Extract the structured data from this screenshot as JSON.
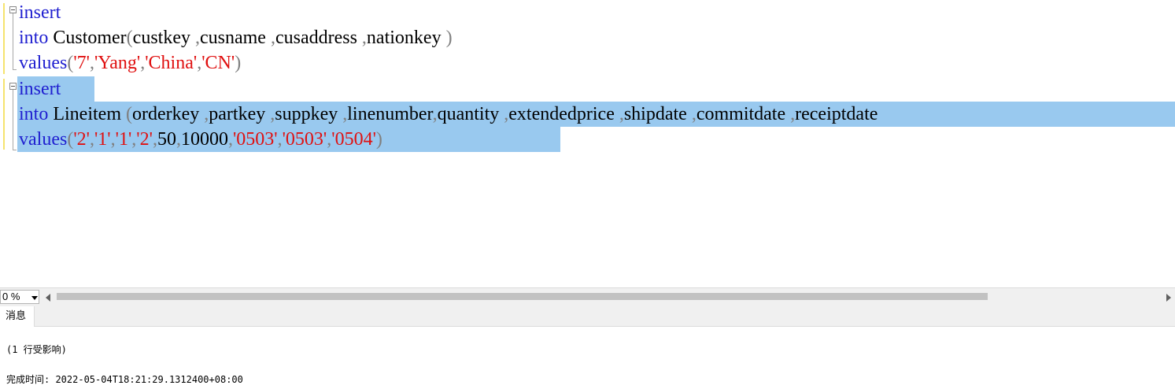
{
  "editor": {
    "lines": [
      [
        {
          "t": "insert",
          "c": "kw"
        }
      ],
      [
        {
          "t": "into",
          "c": "kw"
        },
        {
          "t": " Customer",
          "c": "txt"
        },
        {
          "t": "(",
          "c": "gray"
        },
        {
          "t": "custkey ",
          "c": "txt"
        },
        {
          "t": ",",
          "c": "gray"
        },
        {
          "t": "cusname ",
          "c": "txt"
        },
        {
          "t": ",",
          "c": "gray"
        },
        {
          "t": "cusaddress ",
          "c": "txt"
        },
        {
          "t": ",",
          "c": "gray"
        },
        {
          "t": "nationkey ",
          "c": "txt"
        },
        {
          "t": ")",
          "c": "gray"
        }
      ],
      [
        {
          "t": "values",
          "c": "kw"
        },
        {
          "t": "(",
          "c": "gray"
        },
        {
          "t": "'7'",
          "c": "str"
        },
        {
          "t": ",",
          "c": "gray"
        },
        {
          "t": "'Yang'",
          "c": "str"
        },
        {
          "t": ",",
          "c": "gray"
        },
        {
          "t": "'China'",
          "c": "str"
        },
        {
          "t": ",",
          "c": "gray"
        },
        {
          "t": "'CN'",
          "c": "str"
        },
        {
          "t": ")",
          "c": "gray"
        }
      ],
      [
        {
          "t": "insert",
          "c": "kw"
        }
      ],
      [
        {
          "t": "into",
          "c": "kw"
        },
        {
          "t": " Lineitem ",
          "c": "txt"
        },
        {
          "t": "(",
          "c": "gray"
        },
        {
          "t": "orderkey ",
          "c": "txt"
        },
        {
          "t": ",",
          "c": "gray"
        },
        {
          "t": "partkey ",
          "c": "txt"
        },
        {
          "t": ",",
          "c": "gray"
        },
        {
          "t": "suppkey ",
          "c": "txt"
        },
        {
          "t": ",",
          "c": "gray"
        },
        {
          "t": "linenumber",
          "c": "txt"
        },
        {
          "t": ",",
          "c": "gray"
        },
        {
          "t": "quantity ",
          "c": "txt"
        },
        {
          "t": ",",
          "c": "gray"
        },
        {
          "t": "extendedprice ",
          "c": "txt"
        },
        {
          "t": ",",
          "c": "gray"
        },
        {
          "t": "shipdate ",
          "c": "txt"
        },
        {
          "t": ",",
          "c": "gray"
        },
        {
          "t": "commitdate ",
          "c": "txt"
        },
        {
          "t": ",",
          "c": "gray"
        },
        {
          "t": "receiptdate",
          "c": "txt"
        }
      ],
      [
        {
          "t": "values",
          "c": "kw"
        },
        {
          "t": "(",
          "c": "gray"
        },
        {
          "t": "'2'",
          "c": "str"
        },
        {
          "t": ",",
          "c": "gray"
        },
        {
          "t": "'1'",
          "c": "str"
        },
        {
          "t": ",",
          "c": "gray"
        },
        {
          "t": "'1'",
          "c": "str"
        },
        {
          "t": ",",
          "c": "gray"
        },
        {
          "t": "'2'",
          "c": "str"
        },
        {
          "t": ",",
          "c": "gray"
        },
        {
          "t": "50",
          "c": "txt"
        },
        {
          "t": ",",
          "c": "gray"
        },
        {
          "t": "10000",
          "c": "txt"
        },
        {
          "t": ",",
          "c": "gray"
        },
        {
          "t": "'0503'",
          "c": "str"
        },
        {
          "t": ",",
          "c": "gray"
        },
        {
          "t": "'0503'",
          "c": "str"
        },
        {
          "t": ",",
          "c": "gray"
        },
        {
          "t": "'0504'",
          "c": "str"
        },
        {
          "t": ")",
          "c": "gray"
        }
      ]
    ]
  },
  "status": {
    "zoom_label": "0 %"
  },
  "results": {
    "tab_label": "消息",
    "rows_affected": "(1 行受影响)",
    "completion_label": "完成时间: ",
    "completion_time": "2022-05-04T18:21:29.1312400+08:00"
  },
  "colors": {
    "keyword": "#1f1fd0",
    "string": "#e01010",
    "punctuation": "#808080",
    "selection": "#99c9ef",
    "change_bar": "#f5e36e"
  }
}
